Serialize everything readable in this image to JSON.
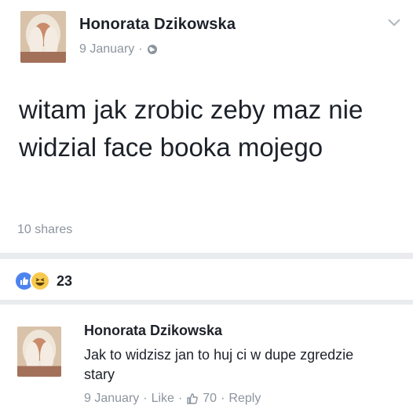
{
  "post": {
    "author": "Honorata Dzikowska",
    "date": "9 January",
    "meta_sep": "·",
    "privacy_icon": "globe-icon",
    "body": "witam jak zrobic zeby maz nie widzial face booka mojego",
    "shares": "10 shares",
    "menu_icon": "chevron-down-icon"
  },
  "reactions": {
    "icons": [
      "like-icon",
      "haha-icon"
    ],
    "count": "23"
  },
  "comment": {
    "author": "Honorata Dzikowska",
    "text": "Jak to widzisz jan to huj ci w dupe zgredzie stary",
    "date": "9 January",
    "sep": "·",
    "like_label": "Like",
    "like_count": "70",
    "reply_label": "Reply"
  },
  "colors": {
    "text": "#1d2129",
    "meta": "#8d949e",
    "separator": "#e9ebee",
    "like_blue": "#4c83ef",
    "haha_yellow": "#f7c94e"
  }
}
